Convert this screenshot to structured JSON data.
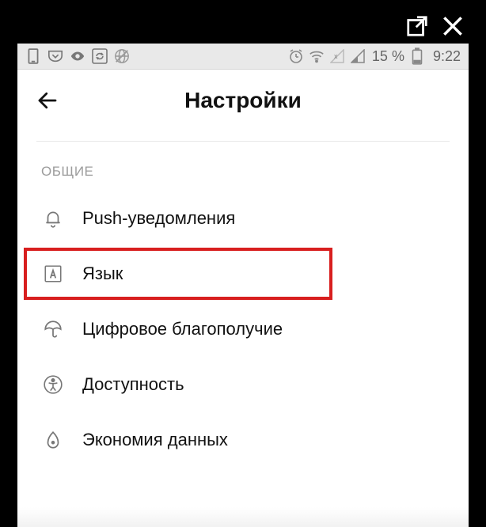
{
  "frame": {
    "open_external_icon": "open-external",
    "close_icon": "close"
  },
  "status": {
    "battery_text": "15 %",
    "clock": "9:22"
  },
  "header": {
    "title": "Настройки"
  },
  "section": {
    "label": "ОБЩИЕ"
  },
  "items": [
    {
      "icon": "bell",
      "label": "Push-уведомления",
      "highlighted": false
    },
    {
      "icon": "language",
      "label": "Язык",
      "highlighted": true
    },
    {
      "icon": "umbrella",
      "label": "Цифровое благополучие",
      "highlighted": false
    },
    {
      "icon": "accessibility",
      "label": "Доступность",
      "highlighted": false
    },
    {
      "icon": "data-saver",
      "label": "Экономия данных",
      "highlighted": false
    }
  ]
}
